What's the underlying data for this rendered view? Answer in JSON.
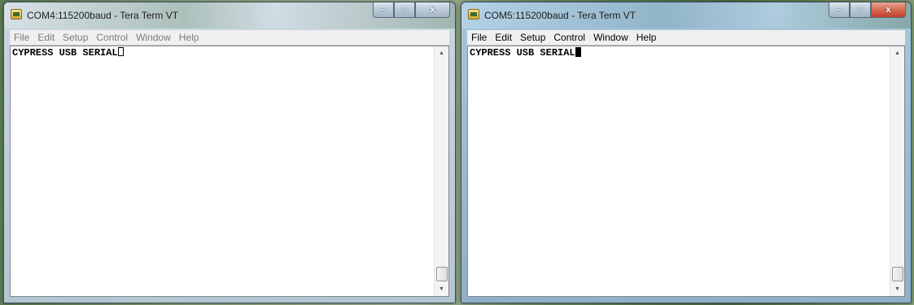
{
  "windows": [
    {
      "title": "COM4:115200baud - Tera Term VT",
      "state": "inactive",
      "menu": [
        "File",
        "Edit",
        "Setup",
        "Control",
        "Window",
        "Help"
      ],
      "terminal_text": "CYPRESS USB SERIAL",
      "cursor": "hollow",
      "caption_buttons": {
        "minimize": "–",
        "maximize": "□",
        "close": "x"
      },
      "scroll": {
        "up": "▲",
        "down": "▼"
      }
    },
    {
      "title": "COM5:115200baud - Tera Term VT",
      "state": "active",
      "menu": [
        "File",
        "Edit",
        "Setup",
        "Control",
        "Window",
        "Help"
      ],
      "terminal_text": "CYPRESS USB SERIAL",
      "cursor": "solid",
      "caption_buttons": {
        "minimize": "–",
        "maximize": "□",
        "close": "x"
      },
      "scroll": {
        "up": "▲",
        "down": "▼"
      }
    }
  ]
}
